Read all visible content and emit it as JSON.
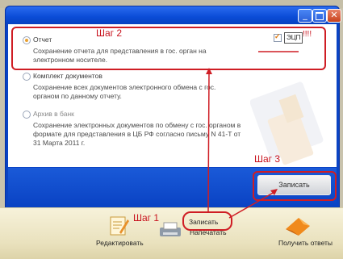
{
  "window": {
    "controls": {
      "minimize": "_",
      "close": "✕"
    }
  },
  "options": [
    {
      "label": "Отчет",
      "description": "Сохранение отчета для представления в гос. орган на электронном носителе.",
      "selected": true
    },
    {
      "label": "Комплект документов",
      "description": "Сохранение всех документов электронного обмена с гос. органом по данному отчету.",
      "selected": false
    },
    {
      "label": "Архив в банк",
      "description": "Сохранение электронных документов по обмену с гос. органом в формате для представления в ЦБ РФ согласно письму N 41-Т от 31 Марта 2011 г.",
      "selected": false
    }
  ],
  "signature": {
    "label": "ЭЦП",
    "checked": true
  },
  "write_button": {
    "label": "Записать"
  },
  "toolbar": {
    "edit": "Редактировать",
    "write": "Записать",
    "print": "Напечатать",
    "receive": "Получить ответы"
  },
  "annotations": {
    "step1": "Шаг 1",
    "step2": "Шаг 2",
    "step3": "Шаг 3",
    "exclaim": "!!!!"
  },
  "colors": {
    "annotation_red": "#cf1d24",
    "window_blue": "#0a43c4",
    "radio_selected": "#e8a030"
  }
}
